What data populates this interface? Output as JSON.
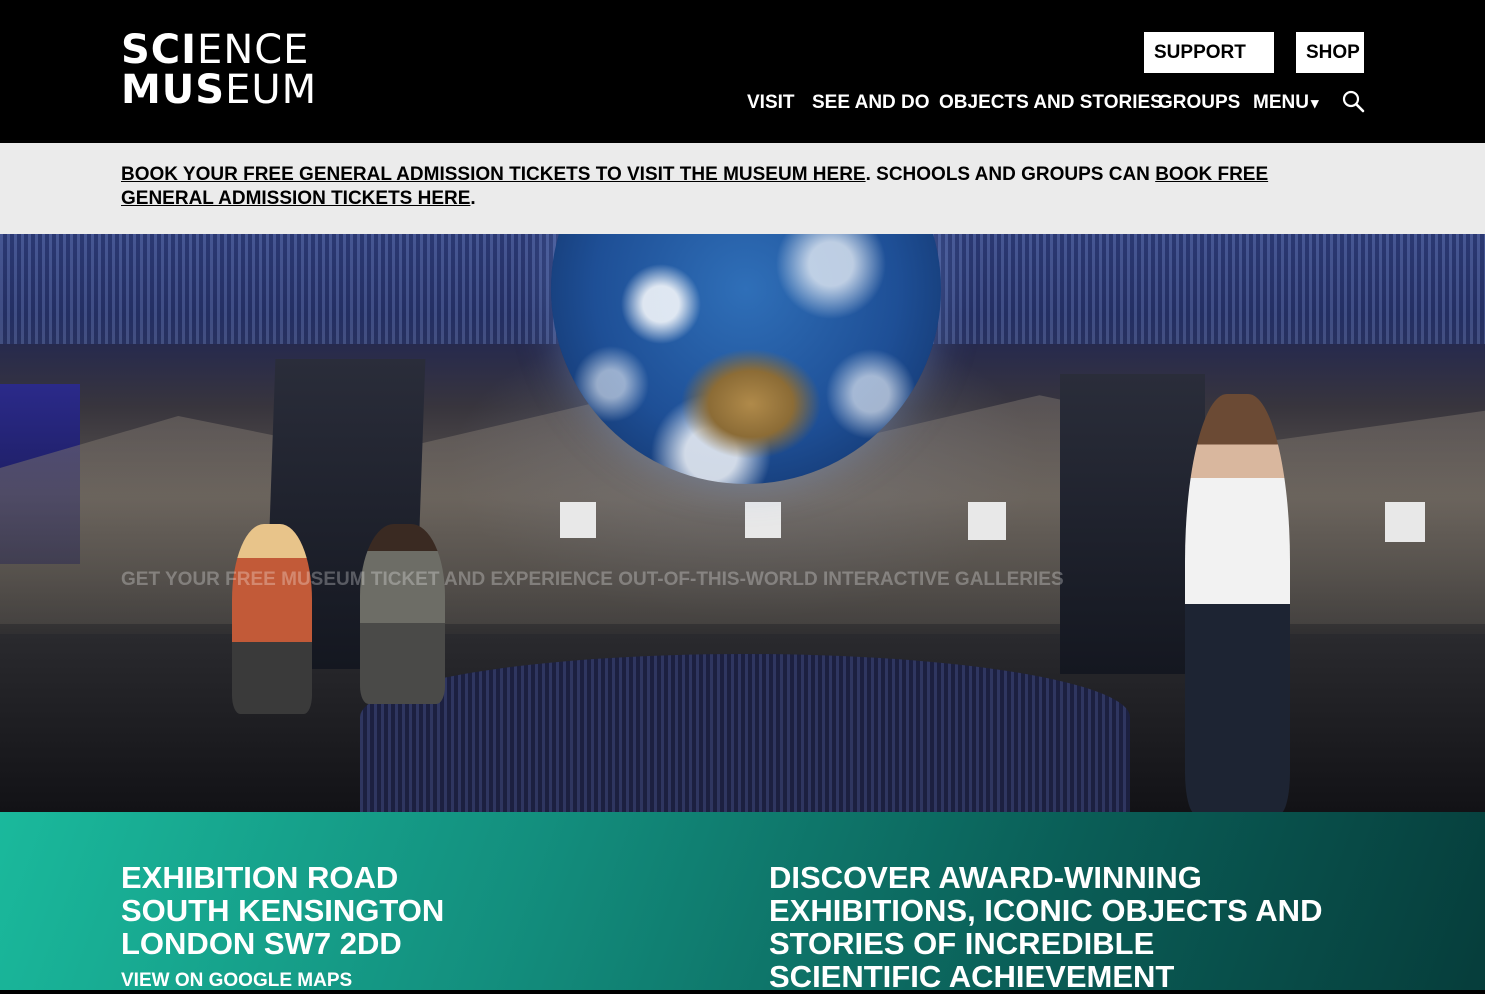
{
  "header": {
    "logo": {
      "line1_bold": "SCI",
      "line1_thin": "ENCE",
      "line2_bold": "MUS",
      "line2_thin": "EUM"
    },
    "utility_buttons": {
      "support": "SUPPORT US",
      "shop": "SHOP"
    },
    "nav": {
      "visit": "VISIT",
      "see_and_do": "SEE AND DO",
      "objects_and_stories": "OBJECTS AND STORIES",
      "groups": "GROUPS",
      "menu": "MENU",
      "menu_caret": "▾"
    },
    "search_icon": "search-icon"
  },
  "alert": {
    "link1": "BOOK YOUR FREE GENERAL ADMISSION TICKETS TO VISIT THE MUSEUM HERE",
    "middle": ". SCHOOLS AND GROUPS CAN ",
    "link2": "BOOK FREE GENERAL ADMISSION TICKETS HERE",
    "end": "."
  },
  "hero": {
    "caption": "GET YOUR FREE MUSEUM TICKET AND EXPERIENCE OUT-OF-THIS-WORLD INTERACTIVE GALLERIES"
  },
  "info": {
    "address": {
      "line1": "EXHIBITION ROAD",
      "line2": "SOUTH KENSINGTON",
      "line3": "LONDON SW7 2DD"
    },
    "maps_link": "VIEW ON GOOGLE MAPS",
    "tagline": "DISCOVER AWARD-WINNING EXHIBITIONS, ICONIC OBJECTS AND STORIES OF INCREDIBLE SCIENTIFIC ACHIEVEMENT"
  },
  "colors": {
    "header_bg": "#000000",
    "alert_bg": "#ebebeb",
    "info_gradient_start": "#1ab99c",
    "info_gradient_end": "#063d3b"
  }
}
